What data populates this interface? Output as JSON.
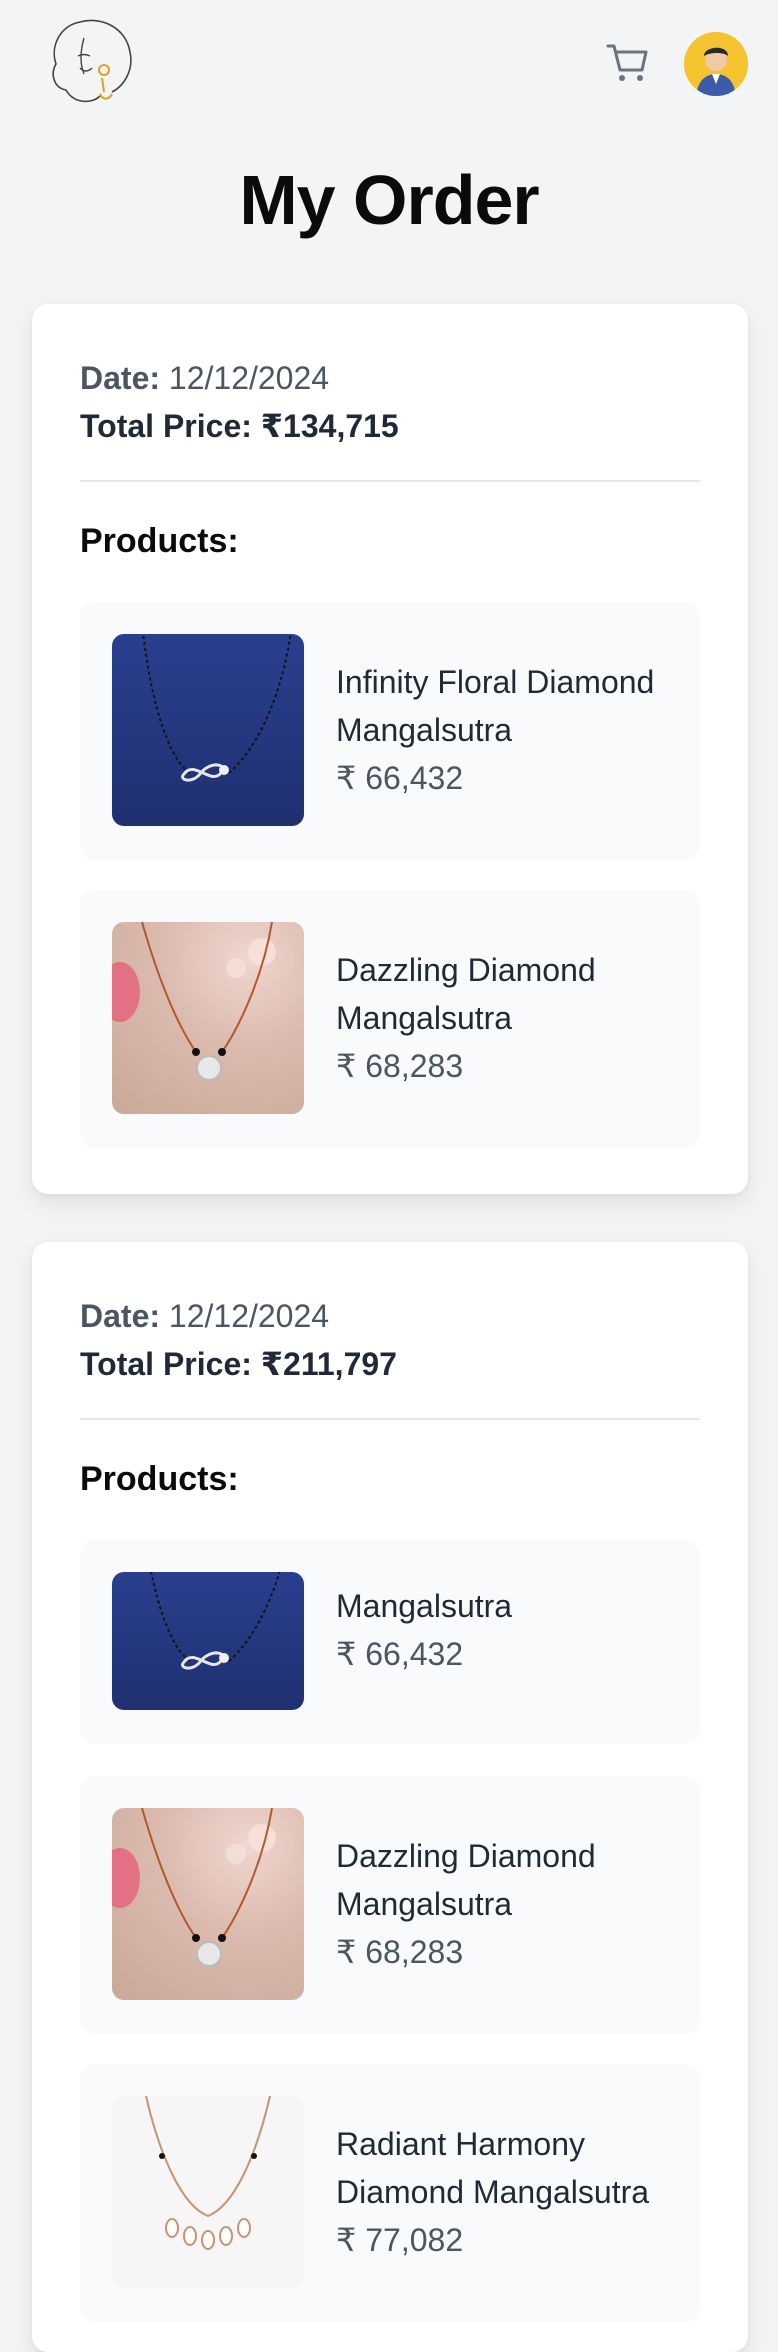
{
  "header": {
    "logo_icon": "woman-face-logo-icon",
    "cart_icon": "cart-icon",
    "avatar_icon": "user-avatar-icon"
  },
  "page": {
    "title": "My Order"
  },
  "labels": {
    "date": "Date:",
    "total": "Total Price:",
    "products": "Products:"
  },
  "orders": [
    {
      "date": "12/12/2024",
      "total": "₹134,715",
      "products": [
        {
          "name": "Infinity Floral Diamond Mangalsutra",
          "price": "₹ 66,432"
        },
        {
          "name": "Dazzling Diamond Mangalsutra",
          "price": "₹ 68,283"
        }
      ]
    },
    {
      "date": "12/12/2024",
      "total": "₹211,797",
      "products": [
        {
          "name": "Mangalsutra",
          "price": "₹ 66,432"
        },
        {
          "name": "Dazzling Diamond Mangalsutra",
          "price": "₹ 68,283"
        },
        {
          "name": "Radiant Harmony Diamond Mangalsutra",
          "price": "₹ 77,082"
        }
      ]
    }
  ]
}
